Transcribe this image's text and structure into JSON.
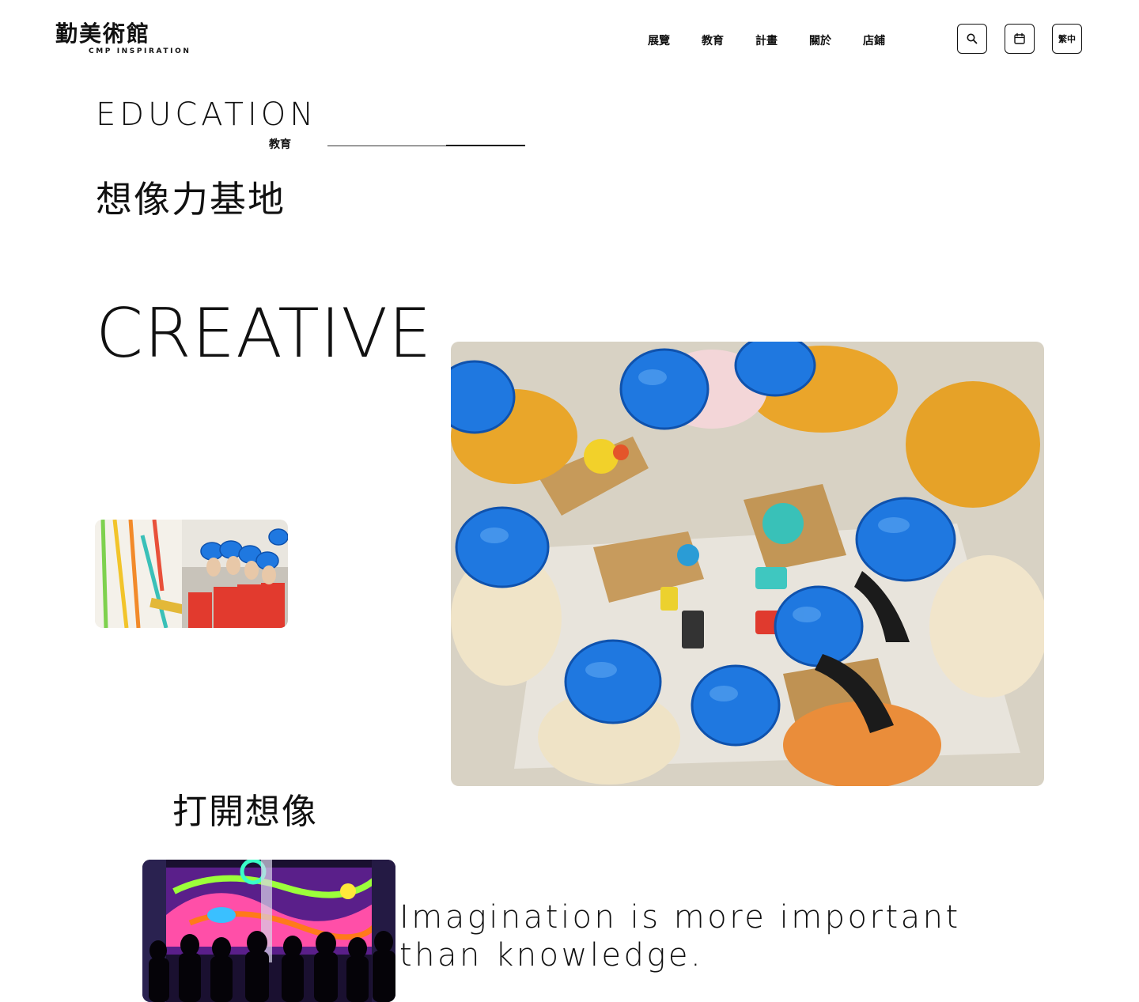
{
  "header": {
    "logo": {
      "cn": "勤美術館",
      "en": "CMP INSPIRATION"
    },
    "nav": [
      {
        "label": "展覽"
      },
      {
        "label": "教育"
      },
      {
        "label": "計畫"
      },
      {
        "label": "關於"
      },
      {
        "label": "店鋪"
      }
    ],
    "search_icon": "search-icon",
    "calendar_icon": "calendar-icon",
    "language": "繁中"
  },
  "section": {
    "title": "EDUCATION",
    "subtitle": "教育",
    "headline": "想像力基地"
  },
  "feature": {
    "title": "CREATIVE",
    "subheadline": "打開想像",
    "quote": "Imagination is more important than knowledge."
  }
}
